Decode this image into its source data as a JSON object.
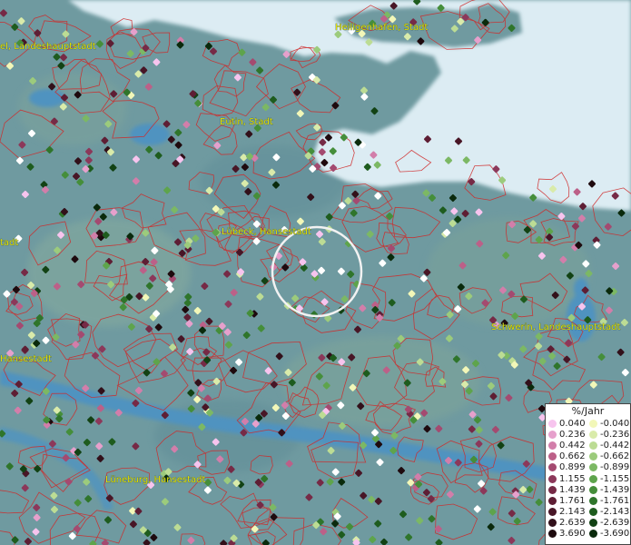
{
  "map": {
    "colors": {
      "sea": "#dcecf3",
      "land": "#6f9aa0",
      "water": "#4f93c0",
      "borders": "#d02828"
    },
    "cities": [
      {
        "id": "heiligenhafen",
        "label": "Heiligenhafen, Stadt"
      },
      {
        "id": "kiel",
        "label": "el, Landeshauptstadt"
      },
      {
        "id": "eutin",
        "label": "Eutin, Stadt"
      },
      {
        "id": "luebeck",
        "label": "Lübeck, Hansestadt"
      },
      {
        "id": "stadt-left",
        "label": "tadt"
      },
      {
        "id": "schwerin",
        "label": "Schwerin, Landeshauptstadt"
      },
      {
        "id": "hansestadt",
        "label": "Hansestadt"
      },
      {
        "id": "lueneburg",
        "label": "Lüneburg, Hansestadt"
      }
    ]
  },
  "legend": {
    "title": "%/Jahr",
    "positive": [
      {
        "value": "0.040",
        "color": "#f7c4ee"
      },
      {
        "value": "0.236",
        "color": "#e6a0cc"
      },
      {
        "value": "0.442",
        "color": "#d27eaa"
      },
      {
        "value": "0.662",
        "color": "#bc6088"
      },
      {
        "value": "0.899",
        "color": "#a44a70"
      },
      {
        "value": "1.155",
        "color": "#8c385a"
      },
      {
        "value": "1.439",
        "color": "#762a46"
      },
      {
        "value": "1.761",
        "color": "#5e1e34"
      },
      {
        "value": "2.143",
        "color": "#481626"
      },
      {
        "value": "2.639",
        "color": "#32101a"
      },
      {
        "value": "3.690",
        "color": "#1e0a0e"
      }
    ],
    "negative": [
      {
        "value": "-0.040",
        "color": "#f2f7b8"
      },
      {
        "value": "-0.236",
        "color": "#d9ebaa"
      },
      {
        "value": "-0.442",
        "color": "#bcdc94"
      },
      {
        "value": "-0.662",
        "color": "#9ccb7c"
      },
      {
        "value": "-0.899",
        "color": "#7cb864"
      },
      {
        "value": "-1.155",
        "color": "#5ea44c"
      },
      {
        "value": "-1.439",
        "color": "#458e3a"
      },
      {
        "value": "-1.761",
        "color": "#2f752b"
      },
      {
        "value": "-2.143",
        "color": "#1e5c1e"
      },
      {
        "value": "-2.639",
        "color": "#124214"
      },
      {
        "value": "-3.690",
        "color": "#0a2a0c"
      }
    ]
  }
}
